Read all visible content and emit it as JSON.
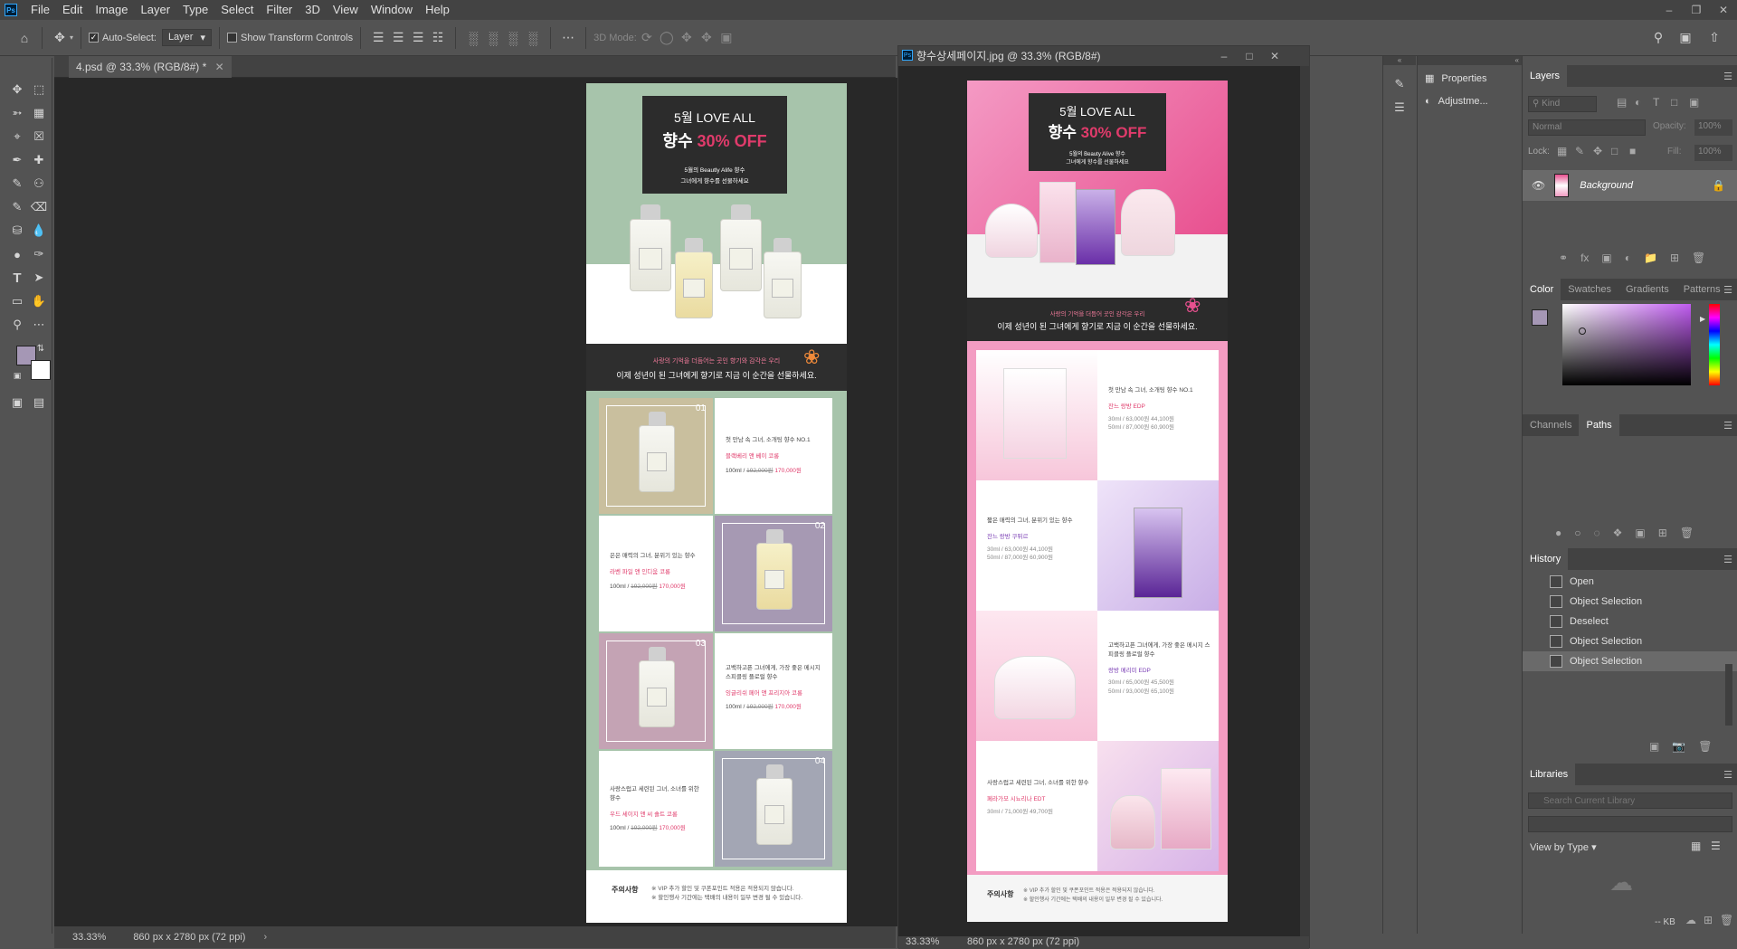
{
  "menubar": {
    "items": [
      "File",
      "Edit",
      "Image",
      "Layer",
      "Type",
      "Select",
      "Filter",
      "3D",
      "View",
      "Window",
      "Help"
    ]
  },
  "options": {
    "auto_select_label": "Auto-Select:",
    "auto_select_value": "Layer",
    "show_transform_label": "Show Transform Controls",
    "mode_3d_label": "3D Mode:"
  },
  "doc1": {
    "tab_title": "4.psd @ 33.3% (RGB/8#) *",
    "hero_line1": "5월 LOVE ALL",
    "hero_line2a": "향수 ",
    "hero_line2b": "30% OFF",
    "hero_sub1": "5월의 Beautly Alife 향수",
    "hero_sub2": "그녀에게 향수를 선물하세요",
    "band_line1": "사랑의 기억을 더듬어는 곳인 향기와 감각은 우리",
    "band_line2": "이제 성년이 된 그녀에게 향기로 지금 이 순간을 선물하세요.",
    "cells": [
      {
        "num": "01",
        "l1": "첫 만남 속 그녀, 소개팅 향수 NO.1",
        "l2": "블랙베리 앤 베이 코롱",
        "l3a": "100ml / ",
        "l3b": "192,000원",
        "l3c": " 170,000원"
      },
      {
        "num": "02",
        "l1": "은은 매력의 그녀, 분위기 있는 향수",
        "l2": "라벤 파일 앤 인디움 코롱",
        "l3a": "100ml / ",
        "l3b": "192,000원",
        "l3c": " 170,000원"
      },
      {
        "num": "03",
        "l1": "고백하고픈 그녀에게, 가장 좋은 메시지 스피클링 플로럴 향수",
        "l2": "잉글리쉬 페어 앤 프리지아 코롱",
        "l3a": "100ml / ",
        "l3b": "192,000원",
        "l3c": " 170,000원"
      },
      {
        "num": "04",
        "l1": "사랑스럽고 세련된 그녀, 소녀를 위한 향수",
        "l2": "우드 세이지 앤 씨 솔트 코롱",
        "l3a": "100ml / ",
        "l3b": "192,000원",
        "l3c": " 170,000원"
      }
    ],
    "notice_title": "주의사항",
    "notice1": "※ VIP 추가 할인 및 쿠폰포인트 적용은 적용되지 않습니다.",
    "notice2": "※ 할인행사 기간에는 택배의 내용이 일부 변경 될 수 있습니다."
  },
  "doc2": {
    "window_title": "향수상세페이지.jpg @ 33.3% (RGB/8#)",
    "hero_line1": "5월 LOVE ALL",
    "hero_line2a": "향수 ",
    "hero_line2b": "30% OFF",
    "hero_sub1": "5월의 Beauty Alive 향수",
    "hero_sub2": "그녀에게 향수를 선물하세요",
    "band_line1": "사랑의 기억을 더듬어 곳인 감각은 우리",
    "band_line2": "이제 성년이 된 그녀에게 향기로 지금 이 순간을 선물하세요.",
    "cells": [
      {
        "l1": "첫 만남 속 그녀, 소개팅 향수 NO.1",
        "l2": "잔느 랑방 EDP",
        "l3": "30ml / 63,000원  44,100원",
        "l4": "50ml / 87,000원  60,900원"
      },
      {
        "l1": "짧은 매력의 그녀, 분위기 있는 향수",
        "l2": "잔느 랑방 쿠튀르",
        "l3": "30ml / 63,000원  44,100원",
        "l4": "50ml / 87,000원  60,900원"
      },
      {
        "l1": "고백하고픈 그녀에게, 가장 좋은 메시지 스피클링 플로럴 향수",
        "l2": "랑방 메리미 EDP",
        "l3": "30ml / 65,000원  45,500원",
        "l4": "50ml / 93,000원  65,100원"
      },
      {
        "l1": "사랑스럽고 세련된 그녀, 소녀를 위한 향수",
        "l2": "페라가모 시뇨리나 EDT",
        "l3": "30ml / 71,000원  49,700원",
        "l4": ""
      }
    ],
    "notice_title": "주의사항",
    "notice1": "※ VIP 추가 할인 및 쿠폰포인트 적용은 적용되지 않습니다.",
    "notice2": "※ 할인행사 기간에는 택배의 내용이 일부 변경 될 수 있습니다."
  },
  "status": {
    "zoom": "33.33%",
    "dims": "860 px x 2780 px (72 ppi)",
    "zoom2": "33.33%",
    "dims2": "860 px x 2780 px (72 ppi)"
  },
  "props": {
    "properties": "Properties",
    "adjustments": "Adjustme..."
  },
  "layers": {
    "tab": "Layers",
    "kind": "Kind",
    "blend": "Normal",
    "opacity_label": "Opacity:",
    "opacity_value": "100%",
    "lock_label": "Lock:",
    "fill_label": "Fill:",
    "fill_value": "100%",
    "layer_name": "Background"
  },
  "color": {
    "tabs": [
      "Color",
      "Swatches",
      "Gradients",
      "Patterns"
    ],
    "fg": "#a597b5",
    "bg": "#ffffff"
  },
  "paths": {
    "tabs": [
      "Channels",
      "Paths"
    ]
  },
  "history": {
    "tab": "History",
    "items": [
      "Open",
      "Object Selection",
      "Deselect",
      "Object Selection",
      "Object Selection"
    ]
  },
  "libraries": {
    "tab": "Libraries",
    "search_placeholder": "Search Current Library",
    "view_by": "View by Type",
    "size": "-- KB"
  }
}
